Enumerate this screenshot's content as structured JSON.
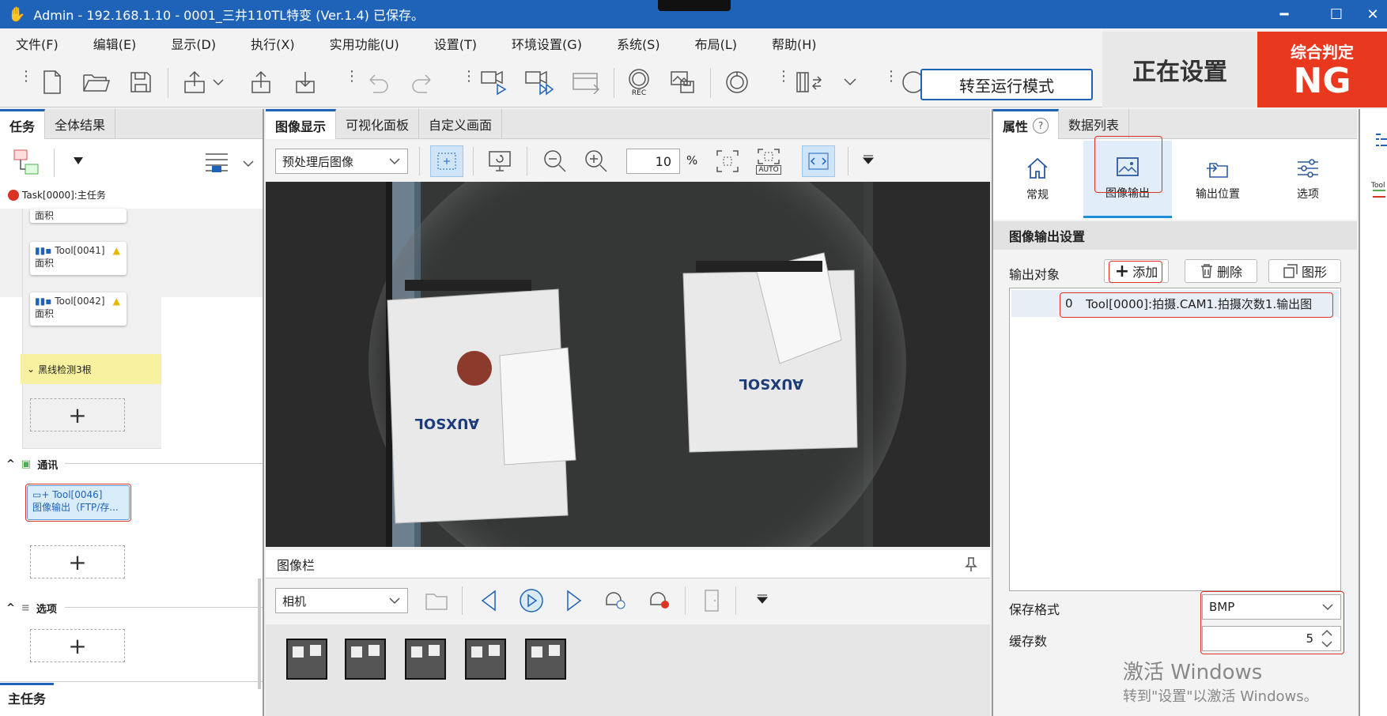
{
  "window": {
    "title": "Admin - 192.168.1.10 - 0001_三井110TL特变 (Ver.1.4) 已保存。",
    "min": "━",
    "max": "☐",
    "close": "✕"
  },
  "menu": [
    "文件(F)",
    "编辑(E)",
    "显示(D)",
    "执行(X)",
    "实用功能(U)",
    "设置(T)",
    "环境设置(G)",
    "系统(S)",
    "布局(L)",
    "帮助(H)"
  ],
  "toolbar": {
    "run_mode": "转至运行模式",
    "rec": "REC"
  },
  "status": {
    "state": "正在设置",
    "judge_label": "综合判定",
    "judge_value": "NG",
    "judge_color": "#e8391e"
  },
  "left": {
    "tabs": [
      "任务",
      "全体结果"
    ],
    "task": "Task[0000]:主任务",
    "partial_label": "面积",
    "tools": [
      {
        "id": "Tool[0041]",
        "name": "面积"
      },
      {
        "id": "Tool[0042]",
        "name": "面积"
      }
    ],
    "group": "黑线检测3根",
    "section_comm": "通讯",
    "tool_comm": {
      "id": "Tool[0046]",
      "name": "图像输出（FTP/存..."
    },
    "section_options": "选项",
    "bottom_tab": "主任务"
  },
  "center": {
    "tabs": [
      "图像显示",
      "可视化面板",
      "自定义画面"
    ],
    "image_select": "预处理后图像",
    "zoom": "10",
    "zoom_unit": "%",
    "auto": "AUTO",
    "imagebar_title": "图像栏",
    "source_select": "相机",
    "brand_text": "AUXSOL"
  },
  "right": {
    "tabs": [
      "属性",
      "数据列表"
    ],
    "categories": [
      "常规",
      "图像输出",
      "输出位置",
      "选项"
    ],
    "section_title": "图像输出设置",
    "output_label": "输出对象",
    "add": "添加",
    "delete": "删除",
    "shape": "图形",
    "list": [
      {
        "index": "0",
        "text": "Tool[0000]:拍摄.CAM1.拍摄次数1.输出图"
      }
    ],
    "format_label": "保存格式",
    "format_value": "BMP",
    "cache_label": "缓存数",
    "cache_value": "5"
  },
  "watermark": {
    "line1": "激活 Windows",
    "line2": "转到\"设置\"以激活 Windows。"
  },
  "far_right": {
    "label": "Tool"
  }
}
